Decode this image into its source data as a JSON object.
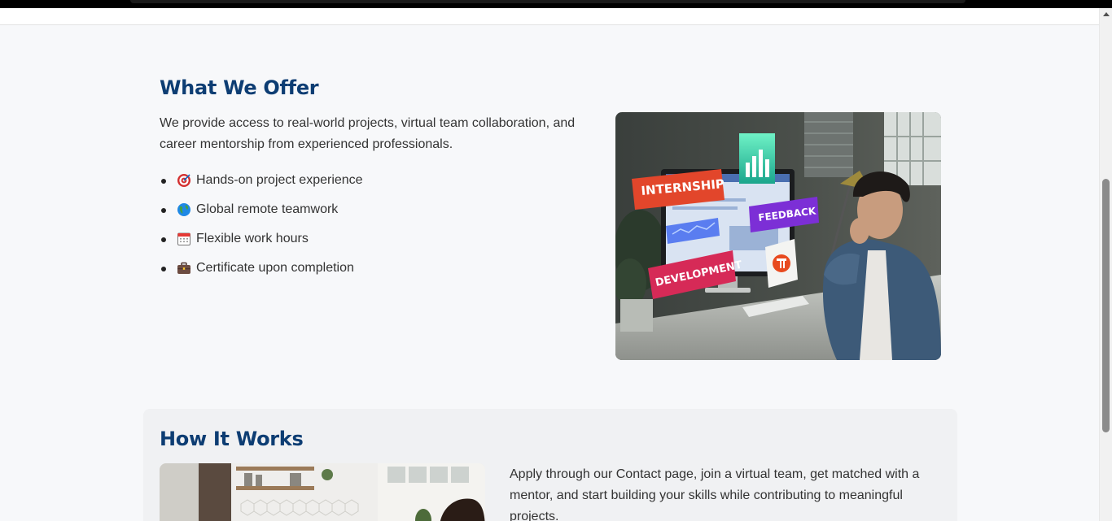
{
  "offer": {
    "title": "What We Offer",
    "description": "We provide access to real-world projects, virtual team collaboration, and career mentorship from experienced professionals.",
    "features": [
      {
        "icon": "target-icon",
        "label": "Hands-on project experience"
      },
      {
        "icon": "globe-icon",
        "label": "Global remote teamwork"
      },
      {
        "icon": "calendar-icon",
        "label": "Flexible work hours"
      },
      {
        "icon": "briefcase-icon",
        "label": "Certificate upon completion"
      }
    ],
    "image_labels": {
      "internship": "INTERNSHIP",
      "feedback": "FEEDBACK",
      "development": "DEVELOPMENT"
    }
  },
  "how": {
    "title": "How It Works",
    "description": "Apply through our Contact page, join a virtual team, get matched with a mentor, and start building your skills while contributing to meaningful projects."
  }
}
